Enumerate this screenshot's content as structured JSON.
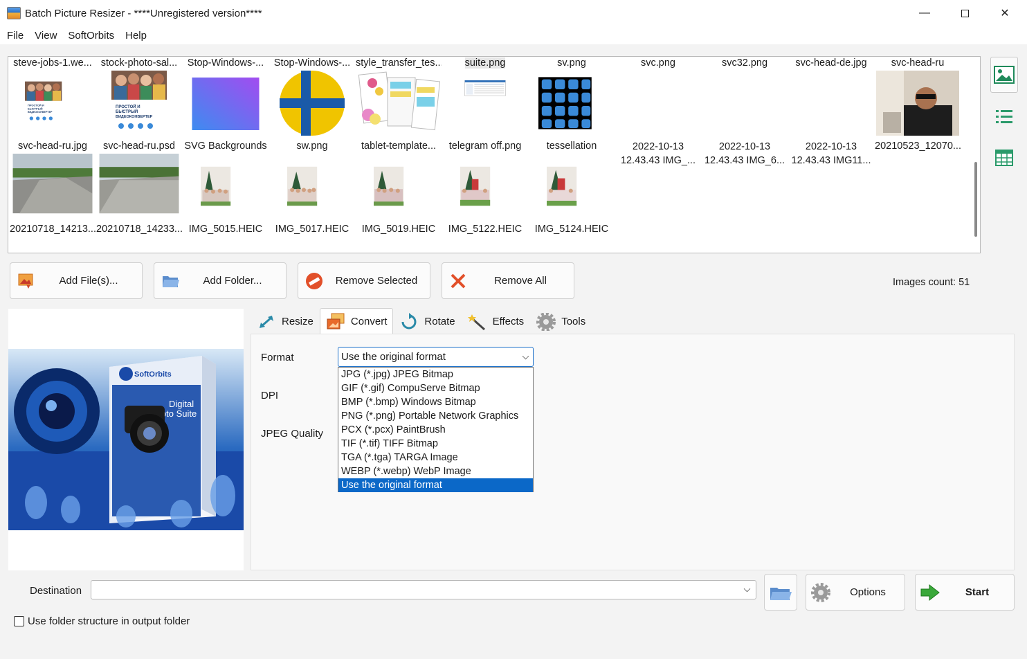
{
  "window": {
    "title": "Batch Picture Resizer - ****Unregistered version****",
    "minimize_glyph": "—",
    "close_glyph": "✕"
  },
  "menu": [
    "File",
    "View",
    "SoftOrbits",
    "Help"
  ],
  "grid": {
    "row0_top_captions": [
      "steve-jobs-1.we...",
      "stock-photo-sal...",
      "Stop-Windows-...",
      "Stop-Windows-...",
      "style_transfer_tes...",
      "suite.png",
      "sv.png",
      "svc.png",
      "svc32.png",
      "svc-head-de.jpg",
      "svc-head-ru"
    ],
    "row1_captions": [
      "svc-head-ru.jpg",
      "svc-head-ru.psd",
      "SVG Backgrounds",
      "sw.png",
      "tablet-template...",
      "telegram off.png",
      "tessellation",
      "2022-10-13 12.43.43 IMG_...",
      "2022-10-13 12.43.43 IMG_6...",
      "2022-10-13 12.43.43 IMG11...",
      "20210523_12070..."
    ],
    "row2_captions": [
      "20210718_14213...",
      "20210718_14233...",
      "IMG_5015.HEIC",
      "IMG_5017.HEIC",
      "IMG_5019.HEIC",
      "IMG_5122.HEIC",
      "IMG_5124.HEIC"
    ],
    "thumb_text": {
      "video_line1": "ПРОСТОЙ И",
      "video_line2": "БЫСТРЫЙ",
      "video_line3": "ВИДЕОКОНВЕРТЕР"
    }
  },
  "actions": {
    "add_files": "Add File(s)...",
    "add_folder": "Add Folder...",
    "remove_selected": "Remove Selected",
    "remove_all": "Remove All",
    "images_count": "Images count: 51"
  },
  "preview": {
    "brand": "SoftOrbits",
    "product_line1": "Digital",
    "product_line2": "Photo Suite"
  },
  "tabs": [
    "Resize",
    "Convert",
    "Rotate",
    "Effects",
    "Tools"
  ],
  "convert": {
    "format_label": "Format",
    "dpi_label": "DPI",
    "jpeg_quality_label": "JPEG Quality",
    "selected_format": "Use the original format",
    "options": [
      "JPG (*.jpg) JPEG Bitmap",
      "GIF (*.gif) CompuServe Bitmap",
      "BMP (*.bmp) Windows Bitmap",
      "PNG (*.png) Portable Network Graphics",
      "PCX (*.pcx) PaintBrush",
      "TIF (*.tif) TIFF Bitmap",
      "TGA (*.tga) TARGA Image",
      "WEBP (*.webp) WebP Image",
      "Use the original format"
    ]
  },
  "bottom": {
    "destination_label": "Destination",
    "destination_value": "",
    "options_label": "Options",
    "start_label": "Start",
    "folder_structure_label": "Use folder structure in output folder"
  },
  "colors": {
    "accent": "#0b68c8",
    "window_bg": "#f3f3f3"
  }
}
